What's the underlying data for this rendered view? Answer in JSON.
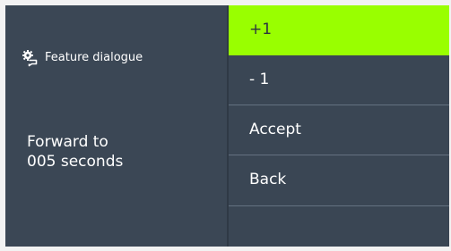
{
  "dialog": {
    "title": "Feature dialogue",
    "icon": "settings-chat-icon",
    "message": {
      "line1": "Forward to",
      "line2": "005 seconds"
    }
  },
  "menu": {
    "items": [
      {
        "label": "+1",
        "state": "selected"
      },
      {
        "label": "- 1"
      },
      {
        "label": "Accept"
      },
      {
        "label": "Back"
      }
    ],
    "accent_color": "#99ff00",
    "background_color": "#3a4654",
    "divider_color": "#647181"
  }
}
